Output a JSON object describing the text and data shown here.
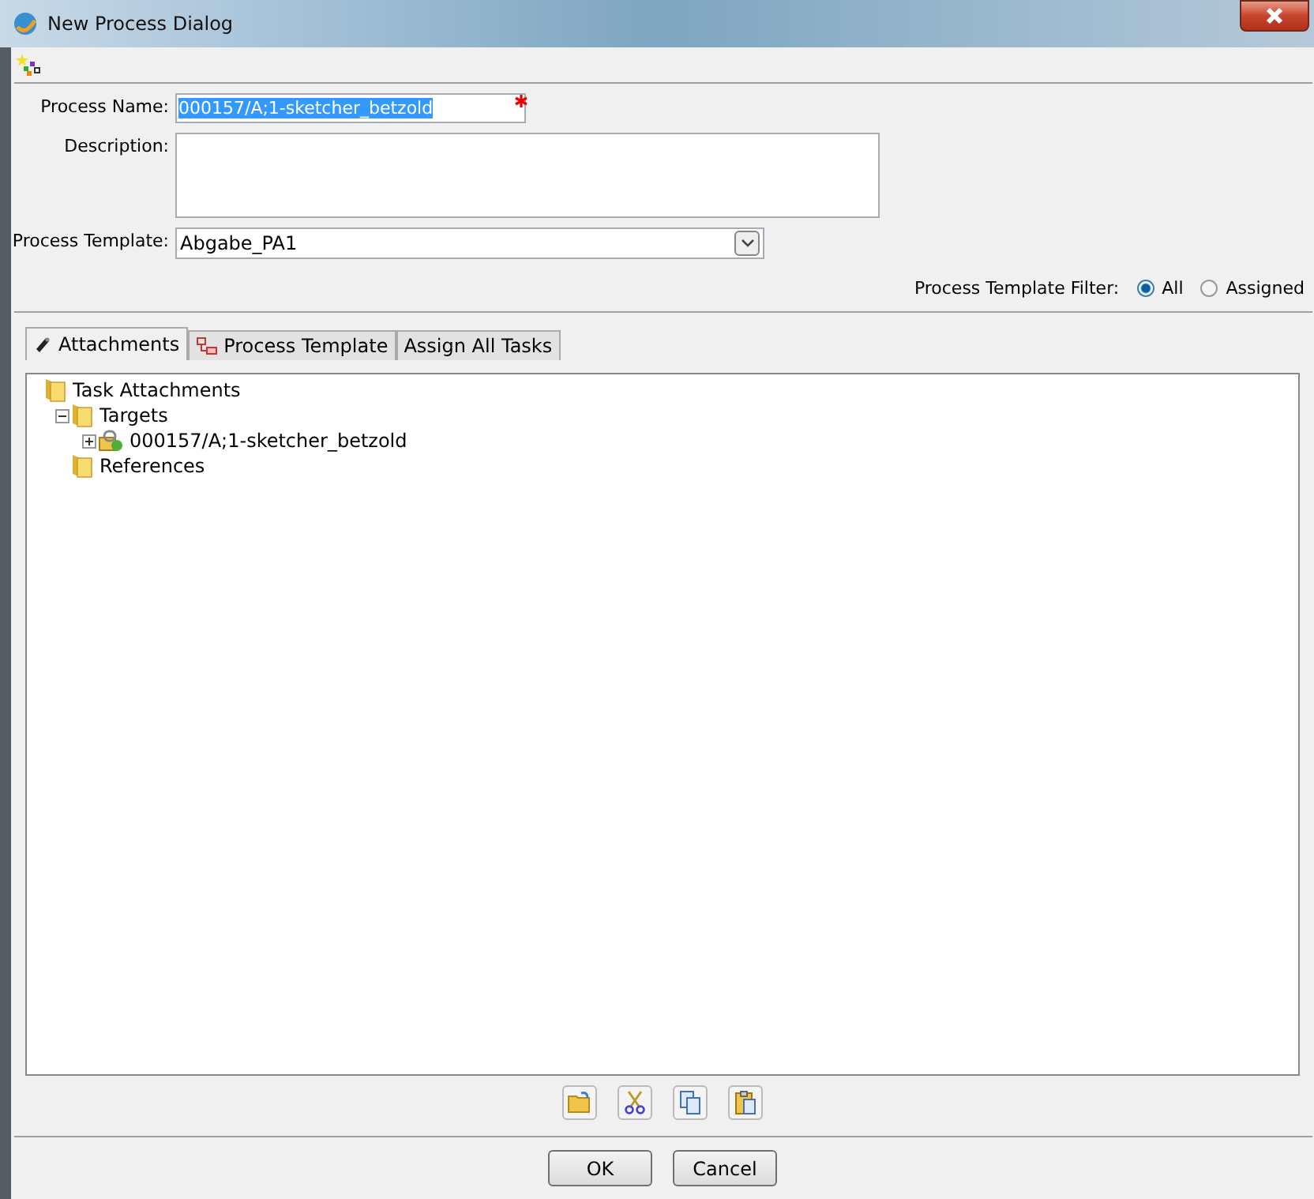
{
  "window": {
    "title": "New Process Dialog"
  },
  "form": {
    "process_name": {
      "label": "Process Name:",
      "value": "000157/A;1-sketcher_betzold",
      "value_selected": true,
      "required": true
    },
    "description": {
      "label": "Description:"
    },
    "process_template": {
      "label": "Process Template:",
      "value": "Abgabe_PA1"
    },
    "filter": {
      "label": "Process Template Filter:",
      "options": [
        {
          "label": "All",
          "selected": true
        },
        {
          "label": "Assigned",
          "selected": false
        }
      ]
    }
  },
  "tabs": [
    {
      "label": "Attachments",
      "kind": "clip",
      "selected": true
    },
    {
      "label": "Process Template",
      "kind": "diagram",
      "selected": false
    },
    {
      "label": "Assign All Tasks",
      "selected": false
    }
  ],
  "tree": [
    {
      "label": "Task Attachments",
      "kind": "folder",
      "children": [
        {
          "label": "Targets",
          "kind": "folder",
          "expanded": true,
          "children": [
            {
              "label": "000157/A;1-sketcher_betzold",
              "kind": "item",
              "expanded": false
            }
          ]
        },
        {
          "label": "References",
          "kind": "folder"
        }
      ]
    }
  ],
  "buttons": [
    "OK",
    "Cancel"
  ]
}
